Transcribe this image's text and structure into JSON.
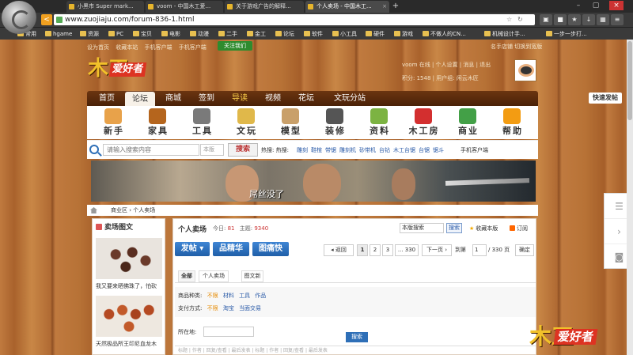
{
  "browser": {
    "tabs": [
      {
        "label": "小黑市 Super mark..."
      },
      {
        "label": "voom - 中国木工爱..."
      },
      {
        "label": "关于游戏广告的解释..."
      },
      {
        "label": "个人卖场 - 中国木工..."
      }
    ],
    "new_tab": "+",
    "url": "www.zuojiaju.com/forum-836-1.html",
    "back": "<",
    "bookmarks": [
      "常用",
      "hgame",
      "资源",
      "PC",
      "宝贝",
      "电影",
      "动漫",
      "二手",
      "金工",
      "论坛",
      "软件",
      "小工具",
      "硬件",
      "游戏",
      "不做人的CN...",
      "机械设计手...",
      "一步一步打..."
    ]
  },
  "header": {
    "top_links": [
      "设为首页",
      "收藏本站",
      "手机客户端",
      "手机客户端"
    ],
    "follow": "关注我们",
    "top_right": "名手店铺  切换到宽版",
    "logo_mark": "木工",
    "logo_brand": "爱好者",
    "user_line1": "voom 在线 | 个人设置 | 消息 | 退出",
    "user_line2": "积分: 1548 | 用户组: 闲云木匠"
  },
  "nav": {
    "items": [
      "首页",
      "论坛",
      "商城",
      "签到",
      "导读",
      "视频",
      "花坛",
      "文玩分站"
    ],
    "post_button": "快速发帖"
  },
  "categories": [
    {
      "label": "新手",
      "color": "#e8a24a"
    },
    {
      "label": "家具",
      "color": "#b5651d"
    },
    {
      "label": "工具",
      "color": "#7a7a7a"
    },
    {
      "label": "文玩",
      "color": "#e0b84a"
    },
    {
      "label": "模型",
      "color": "#c9a06a"
    },
    {
      "label": "装修",
      "color": "#555555"
    },
    {
      "label": "资料",
      "color": "#7cb342"
    },
    {
      "label": "木工房",
      "color": "#d32f2f"
    },
    {
      "label": "商业",
      "color": "#43a047"
    },
    {
      "label": "帮助",
      "color": "#f39c12"
    }
  ],
  "search": {
    "placeholder": "请输入搜索内容",
    "scope": "本版",
    "button": "搜索",
    "hot_label": "热搜: 热搜:",
    "hot_links": [
      "雕刻",
      "鞋楦",
      "带锯",
      "雕刻机",
      "砂带机",
      "台钻",
      "木工台锯",
      "台锯",
      "锯斗"
    ],
    "mobile": "手机客户端"
  },
  "banner": {
    "caption": "屌丝没了"
  },
  "breadcrumb": "商业区 › 个人卖场",
  "sidebar": {
    "title": "卖场图文",
    "items": [
      {
        "caption": "我又要来晒佛珠了，怕砍"
      },
      {
        "caption": "天然极品所王印尼血龙木"
      }
    ]
  },
  "forum": {
    "title": "个人卖场",
    "today_label": "今日:",
    "today": "81",
    "topics_label": "主题:",
    "topics": "9340",
    "in_search_placeholder": "本版搜索",
    "in_search_button": "搜索",
    "favorite": "收藏本版",
    "rss": "订阅",
    "buttons": [
      "发帖 ▾",
      "品精华",
      "图痛快"
    ],
    "pager": {
      "prev": "◂ 返回",
      "pages": [
        "1",
        "2",
        "3",
        "... 330"
      ],
      "next": "下一页 ›",
      "goto_label": "到第",
      "goto_value": "1",
      "total": "/ 330 页",
      "confirm": "确定"
    },
    "tabs": [
      "全部",
      "个人卖场",
      "图文新"
    ],
    "filter_type_label": "商品种类:",
    "filter_type": [
      "不限",
      "材料",
      "工具",
      "作品"
    ],
    "filter_pay_label": "支付方式:",
    "filter_pay": [
      "不限",
      "淘宝",
      "当面交易"
    ],
    "location_label": "所在地:",
    "location_button": "搜索",
    "table_head": "标题  |  作者  |  回复/查看  |  最后发表  |  标题  |  作者  |  回复/查看  |  最后发表"
  }
}
